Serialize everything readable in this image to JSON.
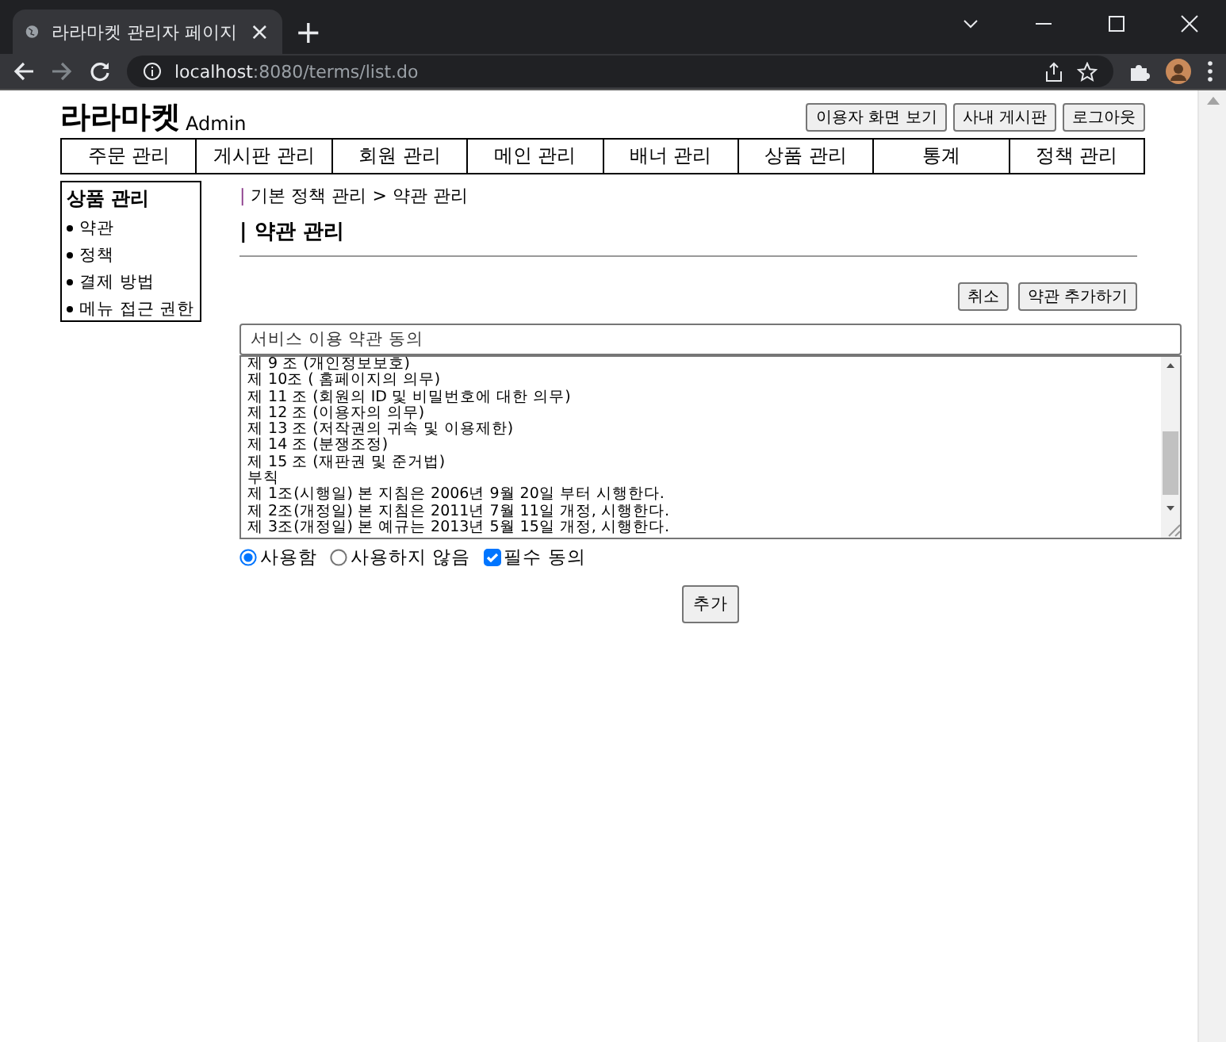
{
  "browser": {
    "tab_title": "라라마켓 관리자 페이지",
    "tab_close": "×",
    "new_tab": "+",
    "url_host": "localhost",
    "url_path": ":8080/terms/list.do"
  },
  "header": {
    "logo": "라라마켓",
    "logo_sub": "Admin",
    "buttons": [
      "이용자 화면 보기",
      "사내 게시판",
      "로그아웃"
    ]
  },
  "nav": [
    "주문 관리",
    "게시판 관리",
    "회원 관리",
    "메인 관리",
    "배너 관리",
    "상품 관리",
    "통계",
    "정책 관리"
  ],
  "sidebar": {
    "title": "상품 관리",
    "items": [
      "약관",
      "정책",
      "결제 방법",
      "메뉴 접근 권한"
    ]
  },
  "breadcrumb": {
    "mark": "|",
    "path": "기본 정책 관리 > 약관 관리"
  },
  "heading": "| 약관 관리",
  "actions": [
    "취소",
    "약관 추가하기"
  ],
  "title_field": {
    "value": "서비스 이용 약관 동의"
  },
  "content_lines": [
    "제 9 조 (개인정보보호)",
    "제 10조 ( 홈페이지의 의무)",
    "제 11 조 (회원의 ID 및 비밀번호에 대한 의무)",
    "제 12 조 (이용자의 의무)",
    "제 13 조 (저작권의 귀속 및 이용제한)",
    "제 14 조 (분쟁조정)",
    "제 15 조 (재판권 및 준거법)",
    "부칙",
    "제 1조(시행일) 본 지침은 2006년 9월 20일 부터 시행한다.",
    "제 2조(개정일) 본 지침은 2011년 7월 11일 개정, 시행한다.",
    "제 3조(개정일) 본 예규는 2013년 5월 15일 개정, 시행한다."
  ],
  "use_options": [
    {
      "label": "사용함",
      "selected": true
    },
    {
      "label": "사용하지 않음",
      "selected": false
    }
  ],
  "required": {
    "label": "필수 동의",
    "checked": true
  },
  "submit": "추가"
}
